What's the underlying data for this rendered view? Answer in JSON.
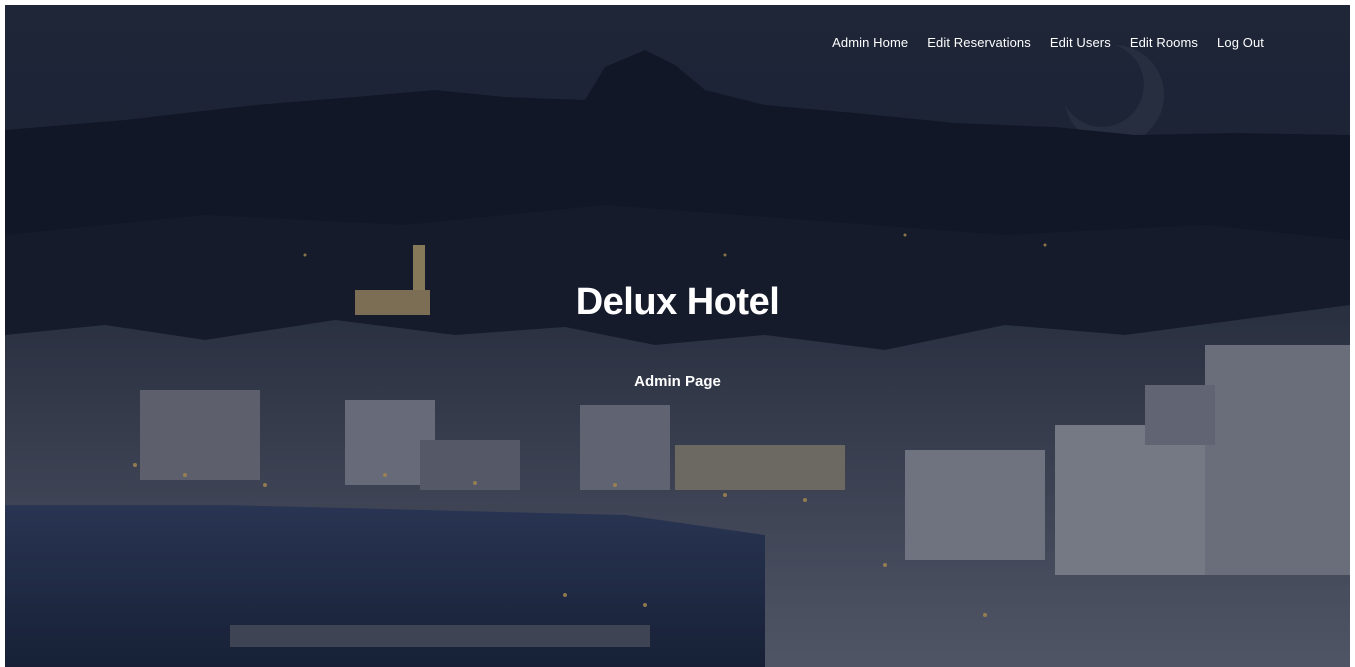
{
  "nav": {
    "items": [
      {
        "label": "Admin Home"
      },
      {
        "label": "Edit Reservations"
      },
      {
        "label": "Edit Users"
      },
      {
        "label": "Edit Rooms"
      },
      {
        "label": "Log Out"
      }
    ]
  },
  "hero": {
    "title": "Delux Hotel",
    "subtitle": "Admin Page",
    "background_image": "night-harbor-town-photo"
  },
  "colors": {
    "sky": "#1d2538",
    "mountain": "#161c2b",
    "water": "#2c3a5e",
    "town": "#8a8a9a",
    "text": "#ffffff"
  }
}
